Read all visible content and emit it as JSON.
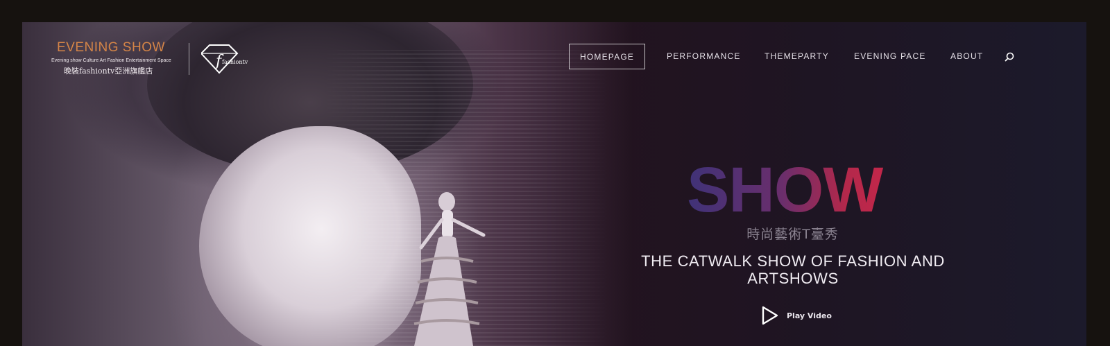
{
  "brand": {
    "logo_text": "EVENING SHOW",
    "logo_tagline": "Evening show Culture Art Fashion Entertainment Space",
    "logo_cn": "晚裝fashiontv亞洲旗艦店",
    "partner_logo_text": "fashiontv"
  },
  "nav": {
    "items": [
      {
        "label": "HOMEPAGE",
        "active": true
      },
      {
        "label": "PERFORMANCE",
        "active": false
      },
      {
        "label": "THEMEPARTY",
        "active": false
      },
      {
        "label": "EVENING PACE",
        "active": false
      },
      {
        "label": "ABOUT",
        "active": false
      }
    ],
    "search_icon": "search-icon"
  },
  "hero": {
    "title": "SHOW",
    "subtitle_cn": "時尚藝術T臺秀",
    "headline": "THE CATWALK SHOW OF FASHION AND ARTSHOWS",
    "play_label": "Play Video",
    "play_icon": "play-icon"
  },
  "colors": {
    "logo": "#d58547",
    "title_gradient_start": "#3f3278",
    "title_gradient_end": "#c8264a",
    "text": "#f0ecf2"
  }
}
